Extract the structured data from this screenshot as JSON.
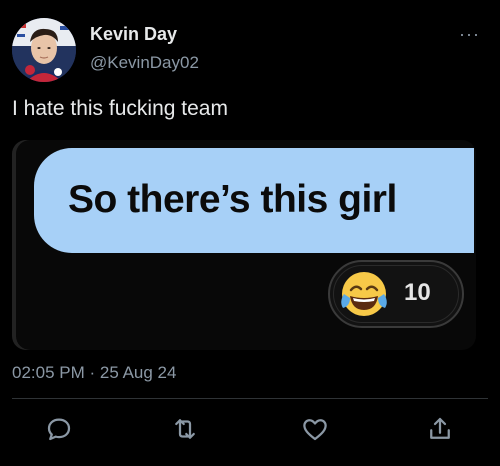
{
  "user": {
    "display_name": "Kevin Day",
    "handle": "@KevinDay02"
  },
  "header": {
    "more_label": "···"
  },
  "tweet": {
    "text": "I hate this fucking team",
    "timestamp": "02:05 PM · 25 Aug 24"
  },
  "media": {
    "message_text": "So there’s this girl",
    "reaction_emoji": "face-with-tears-of-joy",
    "reaction_count": "10"
  },
  "actions": [
    {
      "icon": "reply-icon"
    },
    {
      "icon": "retweet-icon"
    },
    {
      "icon": "like-icon"
    },
    {
      "icon": "share-icon"
    }
  ],
  "colors": {
    "background": "#000000",
    "bubble": "#a7d0f7",
    "secondary_text": "#8b98a5",
    "emoji_yellow": "#f7c948"
  }
}
